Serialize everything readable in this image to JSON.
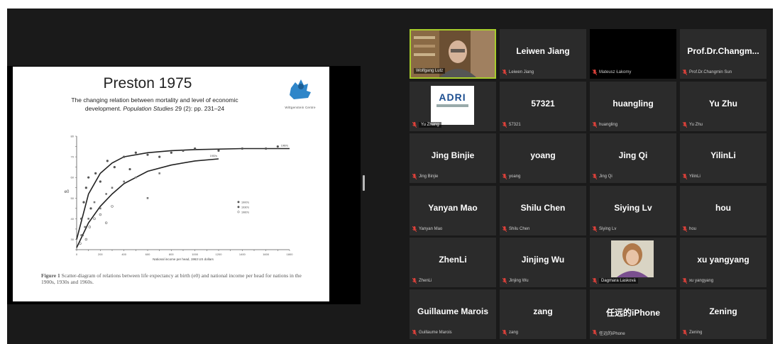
{
  "slide": {
    "title": "Preston 1975",
    "citation_line1": "The changing relation between mortality and level of economic",
    "citation_line2_a": "development.",
    "citation_line2_b": "Population Studies",
    "citation_line2_c": "29 (2): pp. 231–24",
    "logo_caption": "Wittgenstein Centre",
    "figure_caption_label": "Figure 1",
    "figure_caption_text": "Scatter-diagram of relations between life expectancy at birth (e0) and national income per head for nations in the 1900s, 1930s and 1960s.",
    "x_axis_label": "National income per head, 1963 US dollars",
    "curve_label_upper": "1960's",
    "curve_label_lower": "1930's",
    "y_axis_label": "e0"
  },
  "chart_data": {
    "type": "scatter",
    "title": "",
    "xlabel": "National income per head, 1963 US dollars",
    "ylabel": "e0",
    "xlim": [
      0,
      1800
    ],
    "ylim": [
      25,
      80
    ],
    "legend": [
      "1900's",
      "1930's",
      "1960's"
    ],
    "legend_position": "middle-right",
    "x_ticks": [
      0,
      100,
      200,
      300,
      400,
      500,
      600,
      700,
      800,
      900,
      1000,
      1100,
      1200,
      1300,
      1400,
      1500,
      1600,
      1700,
      1800
    ],
    "y_ticks": [
      25,
      30,
      35,
      40,
      45,
      50,
      55,
      60,
      65,
      70,
      75,
      80
    ],
    "series": [
      {
        "name": "1960's",
        "x": [
          40,
          60,
          80,
          100,
          120,
          160,
          200,
          260,
          320,
          400,
          450,
          500,
          600,
          700,
          800,
          900,
          1000,
          1200,
          1400,
          1600,
          1700
        ],
        "y": [
          40,
          48,
          55,
          60,
          45,
          62,
          58,
          68,
          65,
          70,
          64,
          72,
          71,
          70,
          72,
          73,
          74,
          73,
          74,
          74,
          75
        ]
      },
      {
        "name": "1930's",
        "x": [
          40,
          70,
          100,
          150,
          200,
          250,
          300,
          400,
          500,
          600,
          700
        ],
        "y": [
          32,
          36,
          40,
          48,
          45,
          52,
          55,
          58,
          60,
          50,
          62
        ]
      },
      {
        "name": "1900's",
        "x": [
          30,
          50,
          80,
          110,
          150,
          200,
          250,
          300
        ],
        "y": [
          28,
          32,
          30,
          36,
          40,
          42,
          38,
          46
        ]
      }
    ],
    "fit_curves": [
      {
        "name": "1960's",
        "x": [
          0,
          100,
          200,
          300,
          400,
          600,
          800,
          1000,
          1400,
          1800
        ],
        "y": [
          30,
          52,
          62,
          67,
          70,
          72,
          73,
          73.5,
          74,
          74
        ]
      },
      {
        "name": "1930's",
        "x": [
          0,
          100,
          200,
          300,
          400,
          600,
          800,
          1000,
          1200
        ],
        "y": [
          26,
          38,
          46,
          52,
          57,
          63,
          66,
          68,
          69
        ]
      }
    ]
  },
  "participants": [
    {
      "name": "",
      "label": "Wolfgang Lutz",
      "type": "video",
      "active": true
    },
    {
      "name": "Leiwen Jiang",
      "label": "Leiwen Jiang"
    },
    {
      "name": "",
      "label": "Mateusz Łakomy",
      "type": "black"
    },
    {
      "name": "Prof.Dr.Changm...",
      "label": "Prof.Dr.Changmin Sun"
    },
    {
      "name": "",
      "label": "Yu Zhang",
      "type": "adri",
      "logo_text": "ADRI"
    },
    {
      "name": "57321",
      "label": "57321"
    },
    {
      "name": "huangling",
      "label": "huangling"
    },
    {
      "name": "Yu Zhu",
      "label": "Yu Zhu"
    },
    {
      "name": "Jing Binjie",
      "label": "Jing Binjie"
    },
    {
      "name": "yoang",
      "label": "yoang"
    },
    {
      "name": "Jing Qi",
      "label": "Jing Qi"
    },
    {
      "name": "YilinLi",
      "label": "YilinLi"
    },
    {
      "name": "Yanyan Mao",
      "label": "Yanyan Mao"
    },
    {
      "name": "Shilu Chen",
      "label": "Shilu Chen"
    },
    {
      "name": "Siying Lv",
      "label": "Siying Lv"
    },
    {
      "name": "hou",
      "label": "hou"
    },
    {
      "name": "ZhenLi",
      "label": "ZhenLi"
    },
    {
      "name": "Jinjing Wu",
      "label": "Jinjing Wu"
    },
    {
      "name": "",
      "label": "Dagmara Lasková",
      "type": "video2"
    },
    {
      "name": "xu yangyang",
      "label": "xu yangyang"
    },
    {
      "name": "Guillaume Marois",
      "label": "Guillaume Marois"
    },
    {
      "name": "zang",
      "label": "zang"
    },
    {
      "name": "任远的iPhone",
      "label": "任远的iPhone"
    },
    {
      "name": "Zening",
      "label": "Zening"
    }
  ],
  "colors": {
    "active_border": "#a8cd2c",
    "mic_muted": "#e0413a",
    "tile_bg": "#2b2b2b"
  }
}
